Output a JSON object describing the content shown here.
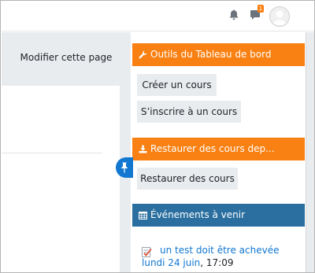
{
  "navbar": {
    "notifications_icon": "bell-icon",
    "messages_icon": "speech-bubble-icon",
    "messages_badge": "1",
    "avatar_icon": "user-avatar-icon"
  },
  "header": {
    "edit_page_button": "Modifier cette page"
  },
  "blocks": {
    "dashboard_tools": {
      "title": "Outils du Tableau de bord",
      "icon": "wrench-icon",
      "buttons": [
        "Créer un cours",
        "S’inscrire à un cours"
      ]
    },
    "restore": {
      "title": "Restaurer des cours dep...",
      "icon": "download-icon",
      "buttons": [
        "Restaurer des cours"
      ]
    },
    "events": {
      "title": "Événements à venir",
      "icon": "calendar-icon",
      "item": {
        "icon": "assignment-icon",
        "name": "un test doit être achevée",
        "date": "lundi 24 juin",
        "time": ", 17:09"
      }
    }
  },
  "colors": {
    "accent_orange": "#f98012",
    "header_blue": "#2a6f9f",
    "link_blue": "#1177d1"
  }
}
